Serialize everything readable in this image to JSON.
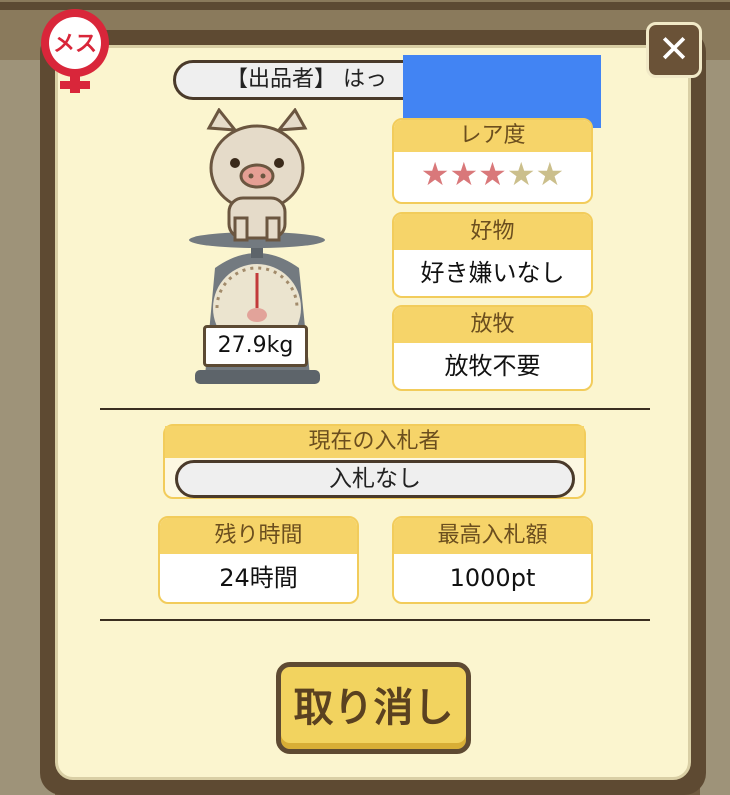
{
  "seller": {
    "label": "【出品者】 はっ"
  },
  "close_icon": "✕",
  "gender_badge": {
    "text": "メス",
    "color": "#d9263a"
  },
  "pig": {
    "weight": "27.9kg"
  },
  "rarity": {
    "label": "レア度",
    "stars_filled": 3,
    "stars_total": 5
  },
  "favorite": {
    "label": "好物",
    "value": "好き嫌いなし"
  },
  "grazing": {
    "label": "放牧",
    "value": "放牧不要"
  },
  "current_bidder": {
    "label": "現在の入札者",
    "value": "入札なし"
  },
  "remaining_time": {
    "label": "残り時間",
    "value": "24時間"
  },
  "highest_bid": {
    "label": "最高入札額",
    "value": "1000pt"
  },
  "cancel_button": {
    "label": "取り消し"
  },
  "colors": {
    "accent": "#f6d469",
    "panel": "#fbf5cf",
    "frame": "#5e4a32",
    "star_on": "#d9787a",
    "star_off": "#cbbf8c"
  }
}
